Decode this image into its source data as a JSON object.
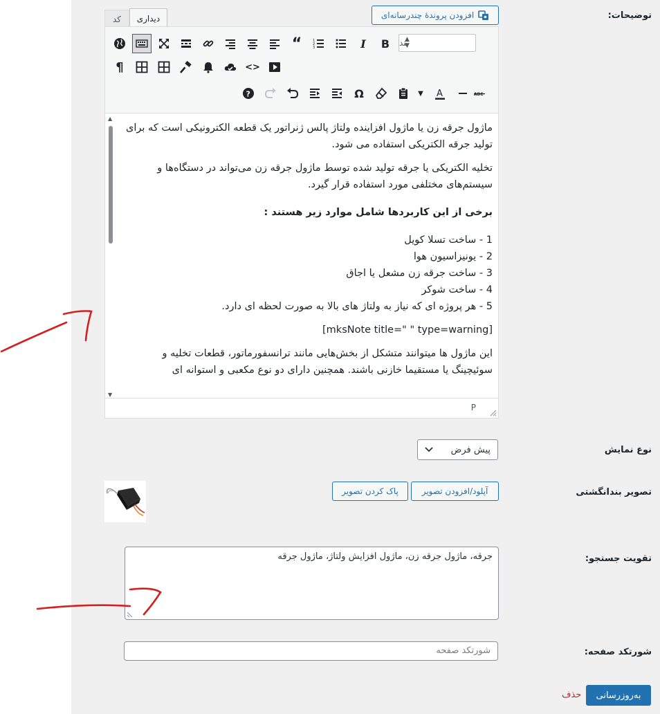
{
  "fields": {
    "description_label": "توضیحات:",
    "display_type_label": "نوع نمایش",
    "thumbnail_label": "تصویر بندانگشتی",
    "search_boost_label": "تقویت جستجو:",
    "shortcode_label": "شورتکد صفحه:"
  },
  "editor": {
    "add_media": "افزودن پروندهٔ چندرسانه‌ای",
    "tab_visual": "دیداری",
    "tab_code": "کد",
    "format_select": "بند",
    "status_path": "P",
    "content": {
      "p1": "ماژول جرقه زن یا ماژول افزاینده ولتاژ پالس ژنراتور یک قطعه الکترونیکی است که برای تولید جرقه الکتریکی استفاده می شود.",
      "p2": "تخلیه الکتریکی یا جرقه تولید شده توسط ماژول جرقه زن می‌تواند در دستگاه‌ها و سیستم‌های مختلفی مورد استفاده قرار گیرد.",
      "heading": "برخی از این کاربردها شامل موارد زیر هستند :",
      "list": [
        "1 - ساخت تسلا کویل",
        "2 - یونیزاسیون هوا",
        "3 - ساخت جرقه زن مشعل یا اجاق",
        "4 - ساخت شوکر",
        "5 - هر پروژه ای که نیاز به ولتاژ های بالا به صورت لحظه ای دارد."
      ],
      "shortcode": "[mksNote title=\" \" type=warning]",
      "p3": "این ماژول ها میتوانند متشکل از بخش‌هایی مانند ترانسفورماتور، قطعات تخلیه و سوئیچینگ یا مستقیما خازنی باشند. همچنین دارای دو نوع مکعبی و استوانه ای"
    }
  },
  "display_type": {
    "selected": "پیش فرض"
  },
  "thumbnail": {
    "upload_button": "آپلود/افزودن تصویر",
    "clear_button": "پاک کردن تصویر"
  },
  "search_boost": {
    "value": "جرقه، ماژول جرقه زن، ماژول افزایش ولتاژ، ماژول جرقه"
  },
  "shortcode": {
    "placeholder": "شورتکد صفحه"
  },
  "actions": {
    "update": "به‌روزرسانی",
    "delete": "حذف"
  },
  "colors": {
    "accent": "#2271b1",
    "danger": "#b32d2e",
    "annotation": "#d32020"
  }
}
